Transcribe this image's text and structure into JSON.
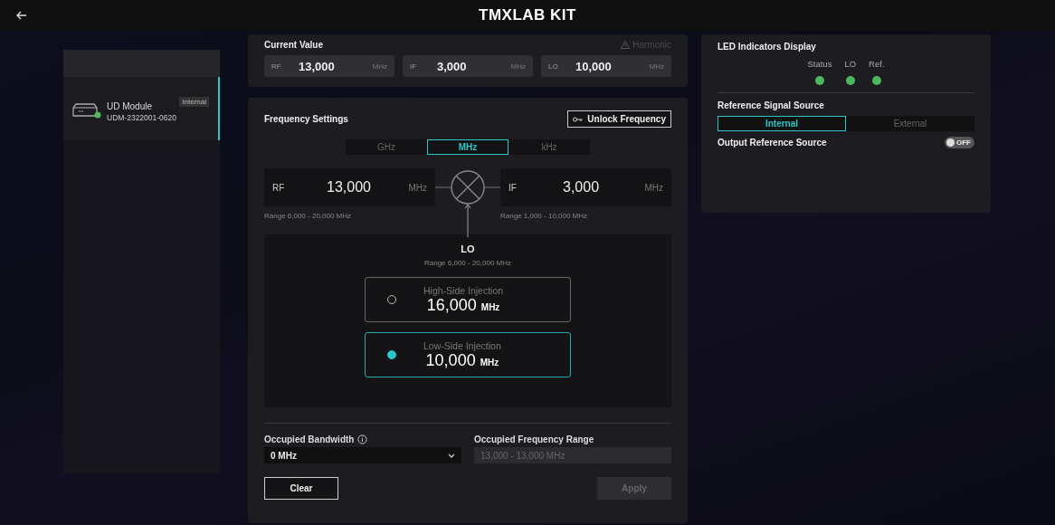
{
  "header": {
    "title": "TMXLAB KIT"
  },
  "sidebar": {
    "items": [
      {
        "name": "UD Module",
        "serial": "UDM-2322001-0620",
        "badge": "Internal",
        "selected": true,
        "online": true
      }
    ]
  },
  "current_value": {
    "title": "Current Value",
    "warning": "Harmonic",
    "fields": [
      {
        "label": "RF",
        "value": "13,000",
        "unit": "MHz"
      },
      {
        "label": "IF",
        "value": "3,000",
        "unit": "MHz"
      },
      {
        "label": "LO",
        "value": "10,000",
        "unit": "MHz"
      }
    ]
  },
  "frequency_settings": {
    "title": "Frequency Settings",
    "unlock_button": "Unlock Frequency",
    "units": [
      {
        "label": "GHz",
        "selected": false
      },
      {
        "label": "MHz",
        "selected": true
      },
      {
        "label": "kHz",
        "selected": false
      }
    ],
    "rf": {
      "label": "RF",
      "value": "13,000",
      "unit": "MHz",
      "range": "Range 6,000 - 20,000 MHz"
    },
    "if": {
      "label": "IF",
      "value": "3,000",
      "unit": "MHz",
      "range": "Range 1,000 - 10,000 MHz"
    },
    "lo": {
      "title": "LO",
      "range": "Range 6,000 - 20,000 MHz",
      "options": [
        {
          "label": "High-Side Injection",
          "value": "16,000",
          "unit": "MHz",
          "selected": false
        },
        {
          "label": "Low-Side Injection",
          "value": "10,000",
          "unit": "MHz",
          "selected": true
        }
      ]
    },
    "bandwidth": {
      "label": "Occupied Bandwidth",
      "value": "0 MHz"
    },
    "frequency_range": {
      "label": "Occupied Frequency Range",
      "value": "13,000 - 13,000 MHz"
    },
    "buttons": [
      {
        "label": "Clear",
        "disabled": false
      },
      {
        "label": "Apply",
        "disabled": true
      }
    ]
  },
  "led_display": {
    "title": "LED Indicators Display",
    "indicators": [
      {
        "label": "Status",
        "on": true
      },
      {
        "label": "LO",
        "on": true
      },
      {
        "label": "Ref.",
        "on": true
      }
    ]
  },
  "reference": {
    "title": "Reference Signal Source",
    "options": [
      {
        "label": "Internal",
        "selected": true
      },
      {
        "label": "External",
        "selected": false
      }
    ]
  },
  "output_reference": {
    "label": "Output Reference Source",
    "on": false,
    "state": "OFF"
  }
}
